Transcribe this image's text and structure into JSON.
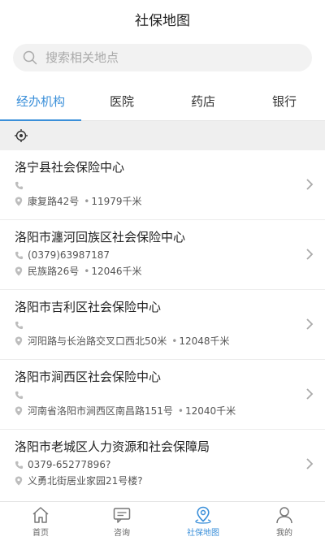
{
  "header": {
    "title": "社保地图"
  },
  "search": {
    "placeholder": "搜索相关地点"
  },
  "tabs": [
    {
      "label": "经办机构",
      "active": true
    },
    {
      "label": "医院",
      "active": false
    },
    {
      "label": "药店",
      "active": false
    },
    {
      "label": "银行",
      "active": false
    }
  ],
  "locate_bar": {
    "icon": "crosshair-icon"
  },
  "list": [
    {
      "name": "洛宁县社会保险中心",
      "phone": "",
      "address": "康复路42号",
      "distance": "11979千米"
    },
    {
      "name": "洛阳市瀍河回族区社会保险中心",
      "phone": "(0379)63987187",
      "address": "民族路26号",
      "distance": "12046千米"
    },
    {
      "name": "洛阳市吉利区社会保险中心",
      "phone": "",
      "address": "河阳路与长治路交叉口西北50米",
      "distance": "12048千米"
    },
    {
      "name": "洛阳市涧西区社会保险中心",
      "phone": "",
      "address": "河南省洛阳市涧西区南昌路151号",
      "distance": "12040千米"
    },
    {
      "name": "洛阳市老城区人力资源和社会保障局",
      "phone": "0379-65277896?",
      "address": "义勇北街居业家园21号楼?",
      "distance": ""
    }
  ],
  "tabbar": [
    {
      "label": "首页",
      "icon": "home-icon",
      "active": false
    },
    {
      "label": "咨询",
      "icon": "chat-icon",
      "active": false
    },
    {
      "label": "社保地图",
      "icon": "map-pin-icon",
      "active": true
    },
    {
      "label": "我的",
      "icon": "user-icon",
      "active": false
    }
  ],
  "colors": {
    "accent": "#3a8fd9",
    "divider": "#ececec",
    "search_bg": "#f2f2f2"
  }
}
